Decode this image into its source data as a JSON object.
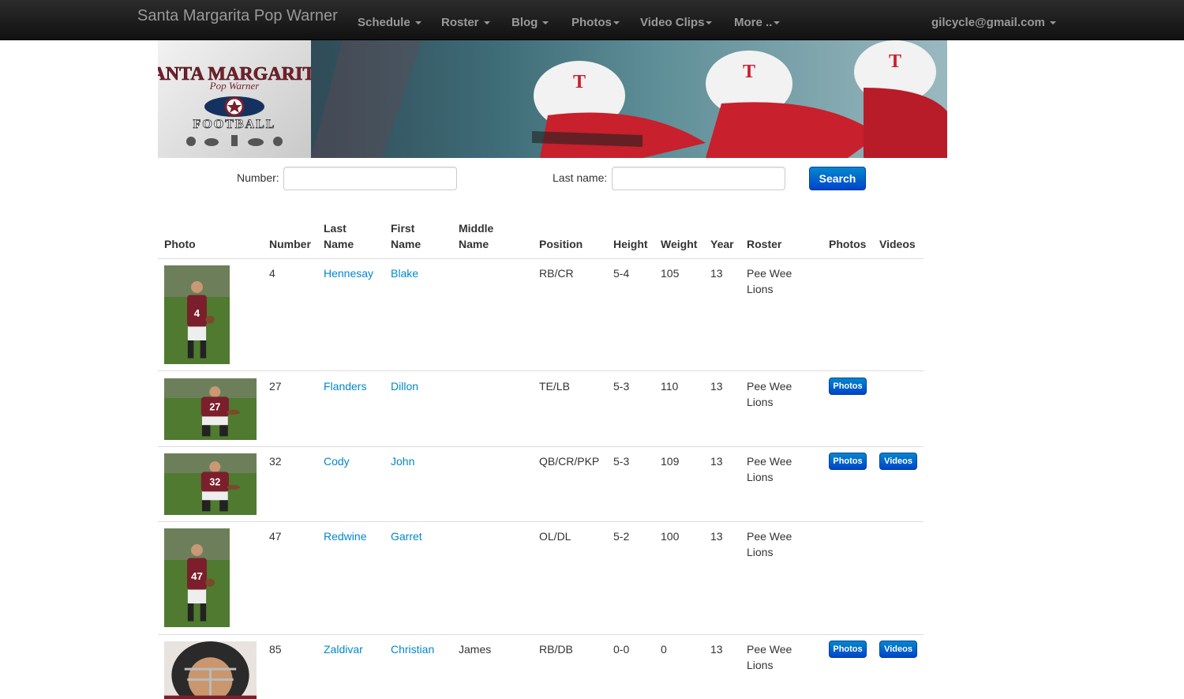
{
  "navbar": {
    "brand": "Santa Margarita Pop Warner",
    "items": [
      {
        "label": "Schedule"
      },
      {
        "label": "Roster"
      },
      {
        "label": "Blog"
      },
      {
        "label": "Photos"
      },
      {
        "label": "Video Clips"
      },
      {
        "label": "More .."
      }
    ],
    "user": "gilcycle@gmail.com"
  },
  "banner": {
    "logo_line1": "SANTA MARGARITA",
    "logo_line2": "Pop Warner",
    "logo_line3": "FOOTBALL"
  },
  "search": {
    "number_label": "Number:",
    "number_value": "",
    "lastname_label": "Last name:",
    "lastname_value": "",
    "button": "Search"
  },
  "table": {
    "headers": {
      "photo": "Photo",
      "number": "Number",
      "last_name_1": "Last",
      "last_name_2": "Name",
      "first_name_1": "First",
      "first_name_2": "Name",
      "middle_name_1": "Middle",
      "middle_name_2": "Name",
      "position": "Position",
      "height": "Height",
      "weight": "Weight",
      "year": "Year",
      "roster": "Roster",
      "photos": "Photos",
      "videos": "Videos"
    },
    "rows": [
      {
        "number": "4",
        "last": "Hennesay",
        "first": "Blake",
        "middle": "",
        "position": "RB/CR",
        "height": "5-4",
        "weight": "105",
        "year": "13",
        "roster_1": "Pee Wee",
        "roster_2": "Lions",
        "photos_btn": "",
        "videos_btn": "",
        "jersey": "4"
      },
      {
        "number": "27",
        "last": "Flanders",
        "first": "Dillon",
        "middle": "",
        "position": "TE/LB",
        "height": "5-3",
        "weight": "110",
        "year": "13",
        "roster_1": "Pee Wee",
        "roster_2": "Lions",
        "photos_btn": "Photos",
        "videos_btn": "",
        "jersey": "27"
      },
      {
        "number": "32",
        "last": "Cody",
        "first": "John",
        "middle": "",
        "position": "QB/CR/PKP",
        "height": "5-3",
        "weight": "109",
        "year": "13",
        "roster_1": "Pee Wee",
        "roster_2": "Lions",
        "photos_btn": "Photos",
        "videos_btn": "Videos",
        "jersey": "32"
      },
      {
        "number": "47",
        "last": "Redwine",
        "first": "Garret",
        "middle": "",
        "position": "OL/DL",
        "height": "5-2",
        "weight": "100",
        "year": "13",
        "roster_1": "Pee Wee",
        "roster_2": "Lions",
        "photos_btn": "",
        "videos_btn": "",
        "jersey": "47"
      },
      {
        "number": "85",
        "last": "Zaldivar",
        "first": "Christian",
        "middle": "James",
        "position": "RB/DB",
        "height": "0-0",
        "weight": "0",
        "year": "13",
        "roster_1": "Pee Wee",
        "roster_2": "Lions",
        "photos_btn": "Photos",
        "videos_btn": "Videos",
        "jersey": ""
      }
    ]
  },
  "colors": {
    "navbar_bg": "#1b1b1b",
    "link": "#0088cc",
    "primary_button": "#0066cc",
    "jersey": "#7a1f2b"
  }
}
